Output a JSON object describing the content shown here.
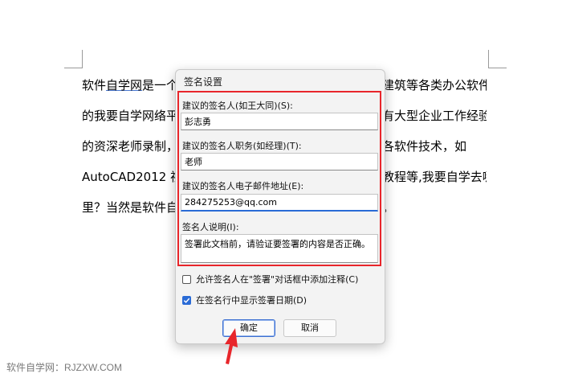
{
  "document": {
    "line1_a": "软件",
    "line1_b": "自学网",
    "line1_c": "是一个",
    "line1_right": "建筑等各类办公软件",
    "line2_left": "的我要自学网络平",
    "line2_right": "有大型企业工作经验",
    "line3_left": "的资深老师录制，",
    "line3_right": "各软件技术，如",
    "line4_left": "AutoCAD2012 视",
    "line4_right": "教程等,我要自学去哪",
    "line5_left": "里？当然是软件自",
    "line5_right": "。"
  },
  "watermark": "软件自学网：RJZXW.COM",
  "dialog": {
    "title": "签名设置",
    "signer_name_label": "建议的签名人(如王大同)(S):",
    "signer_name_value": "彭志勇",
    "signer_title_label": "建议的签名人职务(如经理)(T):",
    "signer_title_value": "老师",
    "signer_email_label": "建议的签名人电子邮件地址(E):",
    "signer_email_value": "284275253@qq.com",
    "instructions_label": "签名人说明(I):",
    "instructions_value": "签署此文档前，请验证要签署的内容是否正确。",
    "allow_comments_label": "允许签名人在\"签署\"对话框中添加注释(C)",
    "allow_comments_checked": false,
    "show_date_label": "在签名行中显示签署日期(D)",
    "show_date_checked": true,
    "ok_label": "确定",
    "cancel_label": "取消"
  },
  "colors": {
    "highlight_border": "#e8262b",
    "arrow": "#e8262b",
    "checkbox_accent": "#2a6bd6"
  }
}
